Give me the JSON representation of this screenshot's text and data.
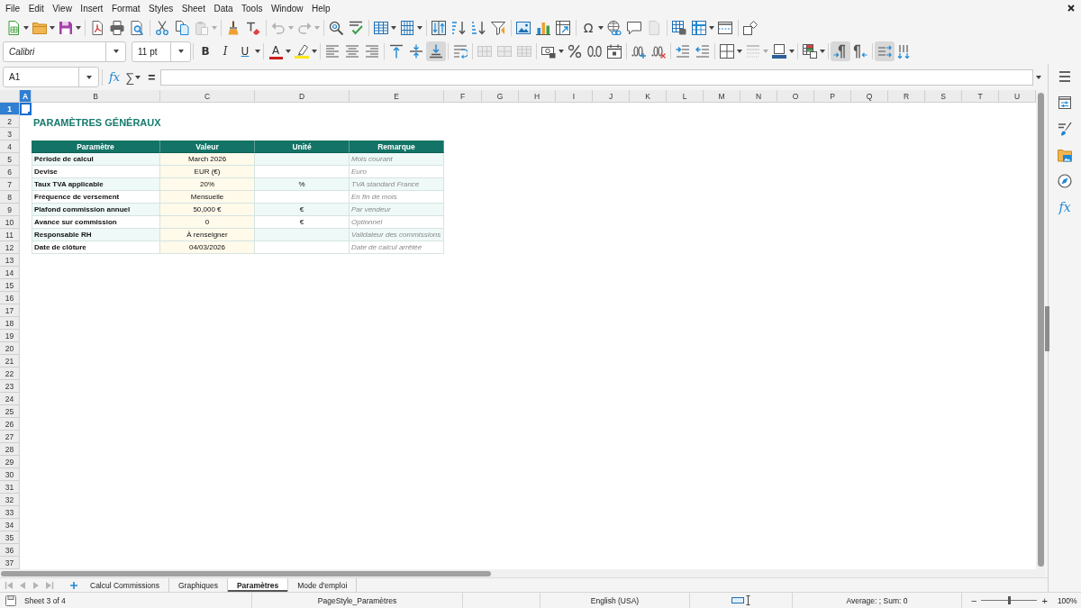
{
  "menu": [
    "File",
    "Edit",
    "View",
    "Insert",
    "Format",
    "Styles",
    "Sheet",
    "Data",
    "Tools",
    "Window",
    "Help"
  ],
  "standard_toolbar": [
    [
      {
        "kind": "new",
        "dropdown": true,
        "disabled": false,
        "on": false
      },
      {
        "kind": "open",
        "dropdown": true,
        "disabled": false,
        "on": false
      },
      {
        "kind": "save",
        "dropdown": true,
        "disabled": false,
        "on": false
      }
    ],
    [
      {
        "kind": "pdf",
        "dropdown": false,
        "disabled": false,
        "on": false
      },
      {
        "kind": "print",
        "dropdown": false,
        "disabled": false,
        "on": false
      },
      {
        "kind": "preview",
        "dropdown": false,
        "disabled": false,
        "on": false
      }
    ],
    [
      {
        "kind": "cut",
        "dropdown": false,
        "disabled": false,
        "on": false
      },
      {
        "kind": "copy",
        "dropdown": false,
        "disabled": false,
        "on": false
      },
      {
        "kind": "paste",
        "dropdown": true,
        "disabled": true,
        "on": false
      }
    ],
    [
      {
        "kind": "clone",
        "dropdown": false,
        "disabled": false,
        "on": false
      },
      {
        "kind": "clear",
        "dropdown": false,
        "disabled": false,
        "on": false
      }
    ],
    [
      {
        "kind": "undo",
        "dropdown": true,
        "disabled": true,
        "on": false
      },
      {
        "kind": "redo",
        "dropdown": true,
        "disabled": true,
        "on": false
      }
    ],
    [
      {
        "kind": "find",
        "dropdown": false,
        "disabled": false,
        "on": false
      },
      {
        "kind": "spelling",
        "dropdown": false,
        "disabled": false,
        "on": false
      }
    ],
    [
      {
        "kind": "row",
        "dropdown": true,
        "disabled": false,
        "on": false
      },
      {
        "kind": "column",
        "dropdown": true,
        "disabled": false,
        "on": false
      }
    ],
    [
      {
        "kind": "sort",
        "dropdown": false,
        "disabled": false,
        "on": false
      },
      {
        "kind": "sort-ascending",
        "dropdown": false,
        "disabled": false,
        "on": false
      },
      {
        "kind": "sort-descending",
        "dropdown": false,
        "disabled": false,
        "on": false
      },
      {
        "kind": "autofilter",
        "dropdown": false,
        "disabled": false,
        "on": false
      }
    ],
    [
      {
        "kind": "image",
        "dropdown": false,
        "disabled": false,
        "on": false
      },
      {
        "kind": "chart",
        "dropdown": false,
        "disabled": false,
        "on": false
      },
      {
        "kind": "pivot-table",
        "dropdown": false,
        "disabled": false,
        "on": false
      }
    ],
    [
      {
        "kind": "special-character",
        "label": "Ω",
        "dropdown": true,
        "disabled": false,
        "on": false
      },
      {
        "kind": "hyperlink",
        "dropdown": false,
        "disabled": false,
        "on": false
      },
      {
        "kind": "comment",
        "dropdown": false,
        "disabled": false,
        "on": false
      },
      {
        "kind": "header-footer",
        "dropdown": false,
        "disabled": true,
        "on": false
      }
    ],
    [
      {
        "kind": "print-area",
        "dropdown": false,
        "disabled": false,
        "on": false
      },
      {
        "kind": "freeze",
        "dropdown": true,
        "disabled": false,
        "on": false
      },
      {
        "kind": "split-window",
        "dropdown": false,
        "disabled": false,
        "on": false
      }
    ],
    [
      {
        "kind": "shapes",
        "dropdown": false,
        "disabled": false,
        "on": false
      }
    ]
  ],
  "formatting_toolbar": {
    "font_name": "Calibri",
    "font_size": "11 pt",
    "groups": [
      [
        {
          "kind": "bold",
          "label": "B",
          "dropdown": false,
          "disabled": false,
          "on": false
        },
        {
          "kind": "italic",
          "label": "I",
          "dropdown": false,
          "disabled": false,
          "on": false
        },
        {
          "kind": "underline",
          "label": "U",
          "dropdown": true,
          "disabled": false,
          "on": false
        }
      ],
      [
        {
          "kind": "font-color",
          "label": "A",
          "dropdown": true,
          "disabled": false,
          "on": false
        },
        {
          "kind": "highlight",
          "dropdown": true,
          "disabled": false,
          "on": false
        }
      ],
      [
        {
          "kind": "align-left",
          "dropdown": false,
          "disabled": false,
          "on": false
        },
        {
          "kind": "align-center",
          "dropdown": false,
          "disabled": false,
          "on": false
        },
        {
          "kind": "align-right",
          "dropdown": false,
          "disabled": false,
          "on": false
        }
      ],
      [
        {
          "kind": "align-top",
          "dropdown": false,
          "disabled": false,
          "on": false
        },
        {
          "kind": "align-middle",
          "dropdown": false,
          "disabled": false,
          "on": false
        },
        {
          "kind": "align-bottom",
          "dropdown": false,
          "disabled": false,
          "on": true
        }
      ],
      [
        {
          "kind": "wrap",
          "dropdown": false,
          "disabled": false,
          "on": false
        }
      ],
      [
        {
          "kind": "merge-center",
          "dropdown": false,
          "disabled": true,
          "on": false
        },
        {
          "kind": "merge",
          "dropdown": false,
          "disabled": true,
          "on": false
        },
        {
          "kind": "unmerge",
          "dropdown": false,
          "disabled": true,
          "on": false
        }
      ],
      [
        {
          "kind": "currency",
          "dropdown": true,
          "disabled": false,
          "on": false
        },
        {
          "kind": "percent",
          "dropdown": false,
          "disabled": false,
          "on": false
        },
        {
          "kind": "standard",
          "dropdown": false,
          "disabled": false,
          "on": false
        },
        {
          "kind": "date",
          "dropdown": false,
          "disabled": false,
          "on": false
        }
      ],
      [
        {
          "kind": "add-decimal",
          "dropdown": false,
          "disabled": false,
          "on": false
        },
        {
          "kind": "delete-decimal",
          "dropdown": false,
          "disabled": false,
          "on": false
        }
      ],
      [
        {
          "kind": "indent-increase",
          "dropdown": false,
          "disabled": false,
          "on": false
        },
        {
          "kind": "indent-decrease",
          "dropdown": false,
          "disabled": false,
          "on": false
        }
      ],
      [
        {
          "kind": "borders",
          "dropdown": true,
          "disabled": false,
          "on": false
        },
        {
          "kind": "border-style",
          "dropdown": true,
          "disabled": true,
          "on": false
        },
        {
          "kind": "border-color",
          "dropdown": true,
          "disabled": false,
          "on": false
        }
      ],
      [
        {
          "kind": "conditional",
          "dropdown": true,
          "disabled": false,
          "on": false
        }
      ],
      [
        {
          "kind": "left-to-right",
          "dropdown": false,
          "disabled": false,
          "on": true
        },
        {
          "kind": "right-to-left",
          "dropdown": false,
          "disabled": false,
          "on": false
        }
      ],
      [
        {
          "kind": "text-left-to-right",
          "dropdown": false,
          "disabled": false,
          "on": true
        },
        {
          "kind": "text-top-to-bottom",
          "dropdown": false,
          "disabled": false,
          "on": false
        }
      ]
    ]
  },
  "formula_bar": {
    "name_box": "A1",
    "function_wizard": "fx",
    "sum": "∑",
    "equals": "="
  },
  "columns": [
    {
      "label": "A",
      "selected": true
    },
    {
      "label": "B",
      "selected": false
    },
    {
      "label": "C",
      "selected": false
    },
    {
      "label": "D",
      "selected": false
    },
    {
      "label": "E",
      "selected": false
    },
    {
      "label": "F",
      "selected": false
    },
    {
      "label": "G",
      "selected": false
    },
    {
      "label": "H",
      "selected": false
    },
    {
      "label": "I",
      "selected": false
    },
    {
      "label": "J",
      "selected": false
    },
    {
      "label": "K",
      "selected": false
    },
    {
      "label": "L",
      "selected": false
    },
    {
      "label": "M",
      "selected": false
    },
    {
      "label": "N",
      "selected": false
    },
    {
      "label": "O",
      "selected": false
    },
    {
      "label": "P",
      "selected": false
    },
    {
      "label": "Q",
      "selected": false
    },
    {
      "label": "R",
      "selected": false
    },
    {
      "label": "S",
      "selected": false
    },
    {
      "label": "T",
      "selected": false
    },
    {
      "label": "U",
      "selected": false
    }
  ],
  "rows": [
    {
      "label": "1",
      "selected": true
    },
    {
      "label": "2",
      "selected": false
    },
    {
      "label": "3",
      "selected": false
    },
    {
      "label": "4",
      "selected": false
    },
    {
      "label": "5",
      "selected": false
    },
    {
      "label": "6",
      "selected": false
    },
    {
      "label": "7",
      "selected": false
    },
    {
      "label": "8",
      "selected": false
    },
    {
      "label": "9",
      "selected": false
    },
    {
      "label": "10",
      "selected": false
    },
    {
      "label": "11",
      "selected": false
    },
    {
      "label": "12",
      "selected": false
    },
    {
      "label": "13",
      "selected": false
    },
    {
      "label": "14",
      "selected": false
    },
    {
      "label": "15",
      "selected": false
    },
    {
      "label": "16",
      "selected": false
    },
    {
      "label": "17",
      "selected": false
    },
    {
      "label": "18",
      "selected": false
    },
    {
      "label": "19",
      "selected": false
    },
    {
      "label": "20",
      "selected": false
    },
    {
      "label": "21",
      "selected": false
    },
    {
      "label": "22",
      "selected": false
    },
    {
      "label": "23",
      "selected": false
    },
    {
      "label": "24",
      "selected": false
    },
    {
      "label": "25",
      "selected": false
    },
    {
      "label": "26",
      "selected": false
    },
    {
      "label": "27",
      "selected": false
    },
    {
      "label": "28",
      "selected": false
    },
    {
      "label": "29",
      "selected": false
    },
    {
      "label": "30",
      "selected": false
    },
    {
      "label": "31",
      "selected": false
    },
    {
      "label": "32",
      "selected": false
    },
    {
      "label": "33",
      "selected": false
    },
    {
      "label": "34",
      "selected": false
    },
    {
      "label": "35",
      "selected": false
    },
    {
      "label": "36",
      "selected": false
    },
    {
      "label": "37",
      "selected": false
    }
  ],
  "sheet": {
    "title": "PARAMÈTRES GÉNÉRAUX",
    "table": {
      "headers": [
        "Paramètre",
        "Valeur",
        "Unité",
        "Remarque"
      ],
      "rows": [
        {
          "parameter": "Période de calcul",
          "value": "March 2026",
          "remark": "Mois courant"
        },
        {
          "parameter": "Devise",
          "value": "EUR (€)",
          "remark": "Euro"
        },
        {
          "parameter": "Taux TVA applicable",
          "value": "20%",
          "unit": "%",
          "remark": "TVA standard France"
        },
        {
          "parameter": "Fréquence de versement",
          "value": "Mensuelle",
          "remark": "En fin de mois"
        },
        {
          "parameter": "Plafond commission annuel",
          "value": "50,000 €",
          "unit": "€",
          "remark": "Par vendeur"
        },
        {
          "parameter": "Avance sur commission",
          "value": "0",
          "unit": "€",
          "remark": "Optionnel"
        },
        {
          "parameter": "Responsable RH",
          "value": "À renseigner",
          "remark": "Validateur des commissions"
        },
        {
          "parameter": "Date de clôture",
          "value": "04/03/2026",
          "remark": "Date de calcul arrêtée"
        }
      ]
    }
  },
  "sheet_navigation": [
    {
      "disabled": true
    },
    {
      "disabled": true
    },
    {
      "disabled": true
    },
    {
      "disabled": true
    }
  ],
  "sheet_tabs": [
    {
      "label": "Calcul Commissions",
      "selected": false
    },
    {
      "label": "Graphiques",
      "selected": false
    },
    {
      "label": "Paramètres",
      "selected": true
    },
    {
      "label": "Mode d'emploi",
      "selected": false
    }
  ],
  "sidebar": {
    "functions": "fx"
  },
  "status_bar": {
    "sheet": "Sheet 3 of 4",
    "page_style": "PageStyle_Paramètres",
    "language": "English (USA)",
    "summary": "Average: ; Sum: 0",
    "zoom_out": "−",
    "zoom_in": "+",
    "zoom": {
      "level": 0.5
    },
    "zoom_percent": "100%"
  }
}
